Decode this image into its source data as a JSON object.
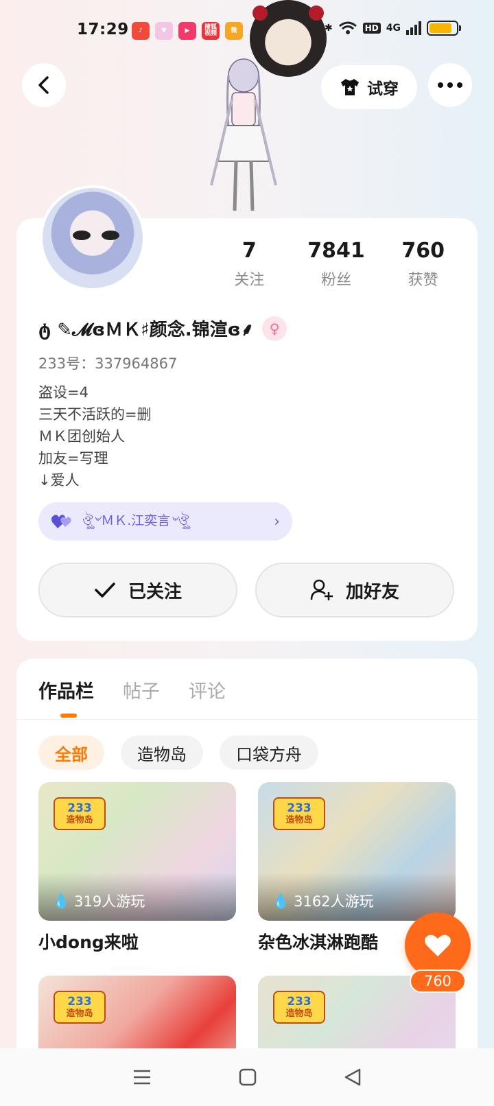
{
  "status_bar": {
    "time": "17:29",
    "app_icons": [
      {
        "name": "music-app-icon",
        "color": "#f04a3a",
        "label": "♪"
      },
      {
        "name": "heart-app-icon",
        "color": "#f2c6e4",
        "label": "♥"
      },
      {
        "name": "video-app-icon",
        "color": "#f23a6a",
        "label": "▶"
      },
      {
        "name": "search-video-app-icon",
        "color": "#e8333a",
        "label": "搜狐视频"
      },
      {
        "name": "weibo-app-icon",
        "color": "#f5a623",
        "label": "微"
      }
    ],
    "network_label": "HD",
    "signal_label": "4G",
    "battery_level": 0.85
  },
  "header": {
    "tryon_label": "试穿"
  },
  "profile": {
    "stats": [
      {
        "value": "7",
        "label": "关注"
      },
      {
        "value": "7841",
        "label": "粉丝"
      },
      {
        "value": "760",
        "label": "获赞"
      }
    ],
    "nickname": "ტ ✎𝓜ɞＭＫ♯颜念.锦渲ɞ⸙",
    "gender_symbol": "♀",
    "uid": "233号：337964867",
    "bio_lines": [
      "盗设=4",
      "三天不活跃的=删",
      "ＭＫ团创始人",
      "加友=写理",
      "↓爱人"
    ],
    "partner_tag": "ঔৣ৺ＭＫ.江奕言৺ঔৣ",
    "follow_label": "已关注",
    "add_friend_label": "加好友"
  },
  "works": {
    "tabs": [
      "作品栏",
      "帖子",
      "评论"
    ],
    "filters": [
      "全部",
      "造物岛",
      "口袋方舟"
    ],
    "badge_line1": "233",
    "badge_line2": "造物岛",
    "items": [
      {
        "title": "小dong来啦",
        "plays": "319人游玩",
        "bg": "linear-gradient(135deg,#e9e7c9 0%,#d7e8c5 35%,#f0d6e2 70%,#cfd7ee 100%)"
      },
      {
        "title": "杂色冰淇淋跑酷",
        "plays": "3162人游玩",
        "bg": "linear-gradient(135deg,#c7dce9 0%,#e9dfbf 40%,#b9d4e6 70%,#e7c9c0 100%)"
      },
      {
        "title": "",
        "plays": "",
        "bg": "linear-gradient(135deg,#f4e3d7 0%,#f0a9a0 40%,#e8403a 65%,#f1ddd3 100%)"
      },
      {
        "title": "",
        "plays": "",
        "bg": "linear-gradient(135deg,#e9e1d0 0%,#d6e7d9 35%,#e9d2e6 65%,#dde2f0 100%)"
      }
    ]
  },
  "like_count": "760",
  "colors": {
    "accent": "#ff7a00",
    "like_fab": "#ff6a1a",
    "partner_tag_bg": "#ebeafd",
    "partner_tag_text": "#6b5fe0"
  }
}
